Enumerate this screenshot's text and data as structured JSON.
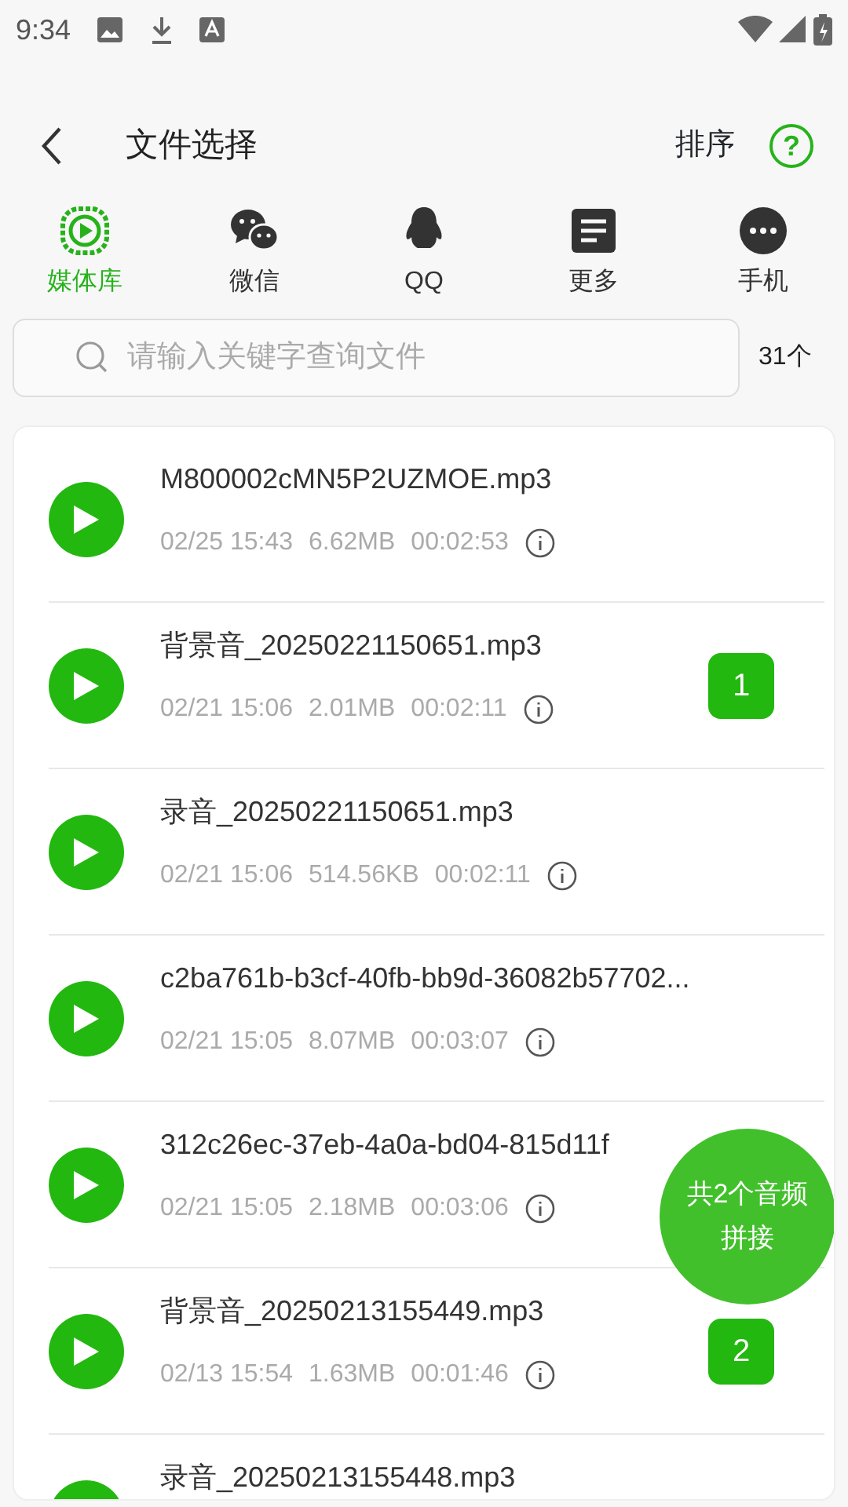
{
  "status_bar": {
    "time": "9:34"
  },
  "header": {
    "title": "文件选择",
    "sort_label": "排序",
    "help_label": "?"
  },
  "tabs": [
    {
      "kind": "media",
      "label": "媒体库",
      "selected": true
    },
    {
      "kind": "wechat",
      "label": "微信",
      "selected": false
    },
    {
      "kind": "qq",
      "label": "QQ",
      "selected": false
    },
    {
      "kind": "more",
      "label": "更多",
      "selected": false
    },
    {
      "kind": "phone",
      "label": "手机",
      "selected": false
    }
  ],
  "search": {
    "placeholder": "请输入关键字查询文件",
    "count": "31个"
  },
  "files": [
    {
      "name": "M800002cMN5P2UZMOE.mp3",
      "date": "02/25 15:43",
      "size": "6.62MB",
      "duration": "00:02:53"
    },
    {
      "name": "背景音_20250221150651.mp3",
      "date": "02/21 15:06",
      "size": "2.01MB",
      "duration": "00:02:11",
      "order": "1"
    },
    {
      "name": "录音_20250221150651.mp3",
      "date": "02/21 15:06",
      "size": "514.56KB",
      "duration": "00:02:11"
    },
    {
      "name": "c2ba761b-b3cf-40fb-bb9d-36082b57702...",
      "date": "02/21 15:05",
      "size": "8.07MB",
      "duration": "00:03:07"
    },
    {
      "name": "312c26ec-37eb-4a0a-bd04-815d11f",
      "date": "02/21 15:05",
      "size": "2.18MB",
      "duration": "00:03:06"
    },
    {
      "name": "背景音_20250213155449.mp3",
      "date": "02/13 15:54",
      "size": "1.63MB",
      "duration": "00:01:46",
      "order": "2"
    },
    {
      "name": "录音_20250213155448.mp3"
    }
  ],
  "merge_button": {
    "line_1": "共2个音频",
    "line_2": "拼接"
  }
}
